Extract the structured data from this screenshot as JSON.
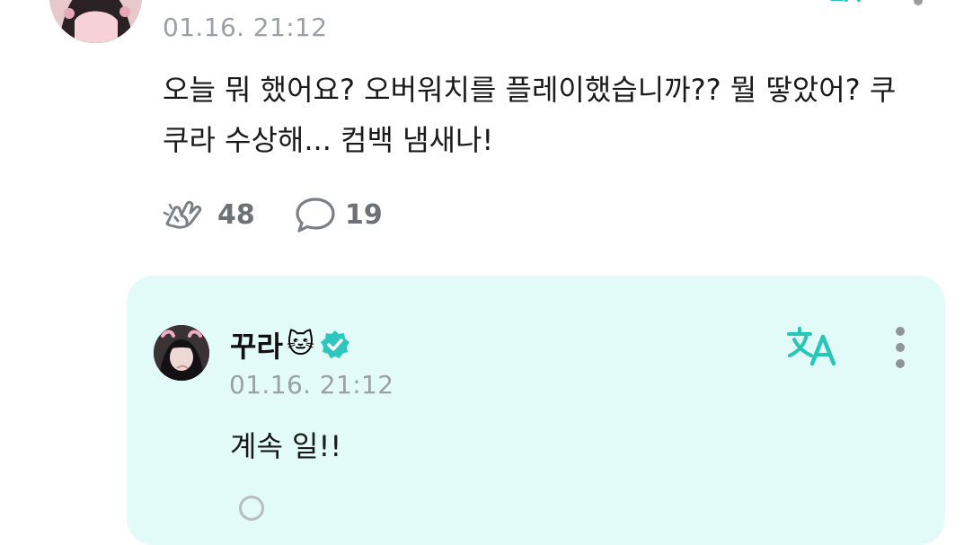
{
  "post": {
    "timestamp": "01.16. 21:12",
    "body": "오늘 뭐 했어요? 오버워치를 플레이했습니까?? 뭘 땋았어? 쿠쿠라 수상해... 컴백 냄새나!",
    "like_count": "48",
    "comment_count": "19"
  },
  "reply": {
    "author_name": "꾸라",
    "author_emoji": "🐱",
    "timestamp": "01.16. 21:12",
    "body": "계속 일!!"
  },
  "colors": {
    "accent": "#27c7b8",
    "reply_background": "#e2fbf8",
    "timestamp": "#9aa0a6",
    "action_icon": "#7b8085"
  },
  "icons": {
    "like": "cheer-hands-icon",
    "comment": "speech-bubble-icon",
    "translate": "translate-icon",
    "more": "more-vertical-icon",
    "verified": "verified-badge-icon"
  }
}
